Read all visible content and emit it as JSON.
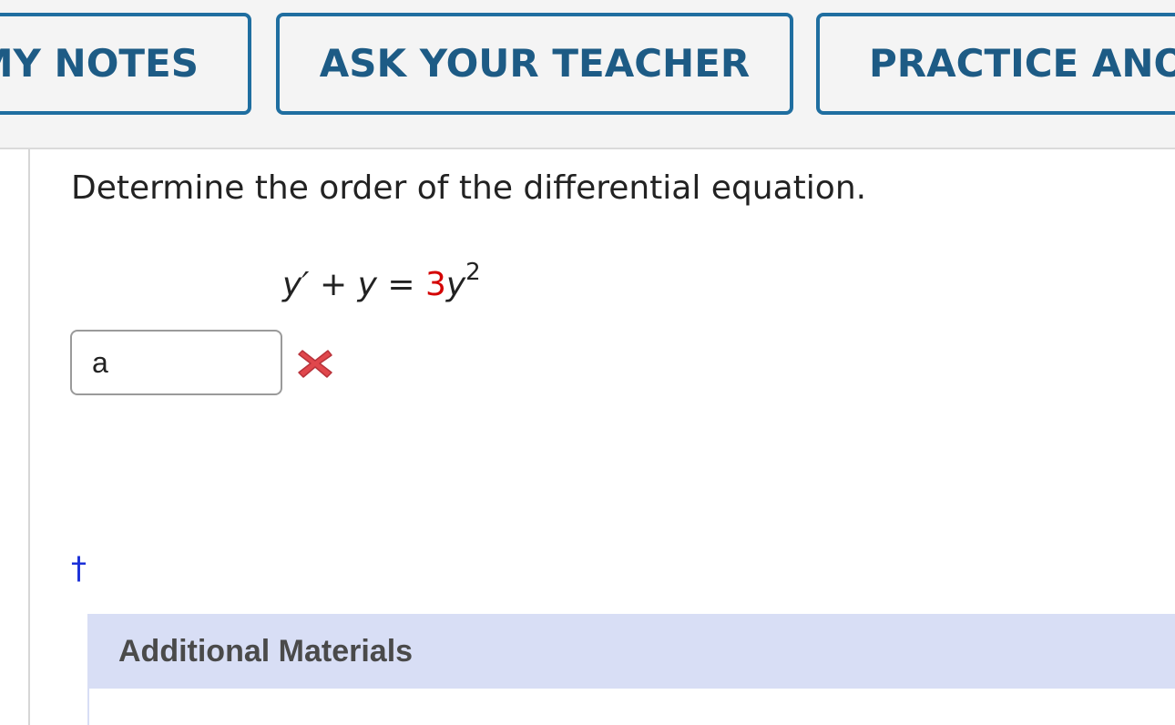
{
  "toolbar": {
    "my_notes_label": "MY NOTES",
    "ask_teacher_label": "ASK YOUR TEACHER",
    "practice_label": "PRACTICE ANO"
  },
  "question": {
    "prompt": "Determine the order of the differential equation.",
    "equation": {
      "y_prime": "y′",
      "plus": "+",
      "y": "y",
      "equals": "=",
      "coefficient": "3",
      "y_power_base": "y",
      "exponent": "2"
    },
    "answer_value": "a",
    "answer_status_icon": "wrong-x-icon"
  },
  "footnote_marker": "†",
  "additional_materials": {
    "title": "Additional Materials"
  },
  "colors": {
    "button_border": "#1f6ea0",
    "button_text": "#1d5b85",
    "coefficient_red": "#d40000",
    "wrong_icon_red": "#e0474c",
    "dagger_blue": "#1b30d8",
    "materials_bg": "#d8def5"
  }
}
